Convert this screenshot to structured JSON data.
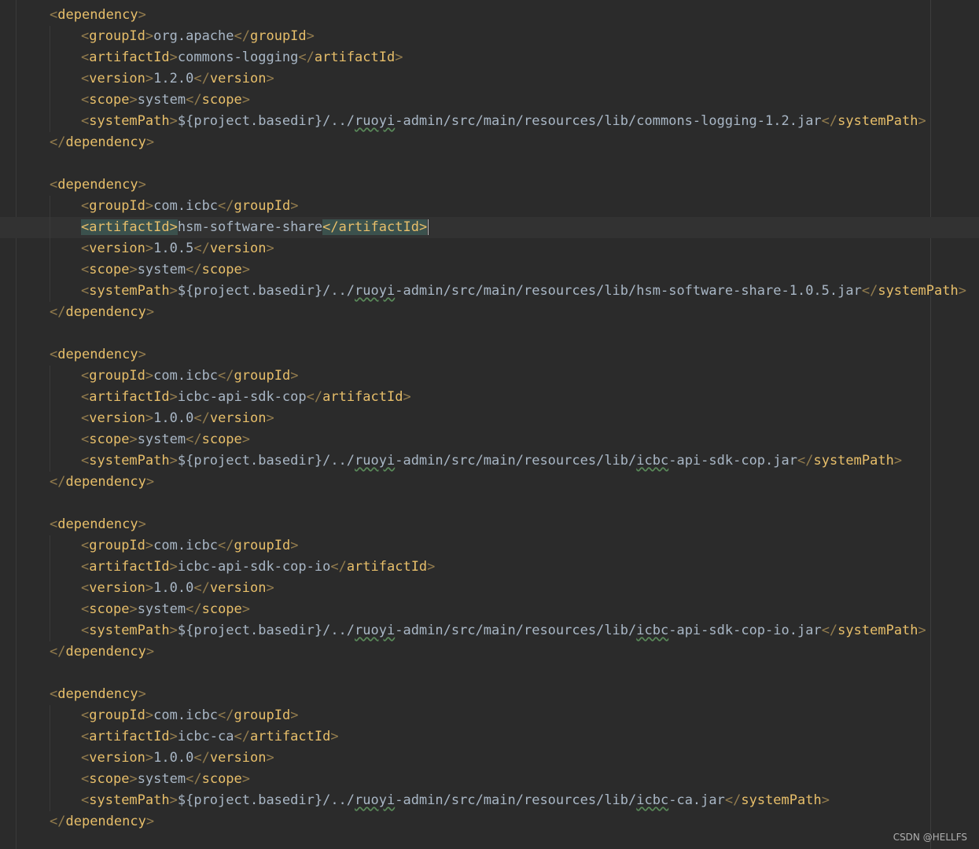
{
  "watermark": "CSDN @HELLFS",
  "current_line": 10,
  "caret_line": 10,
  "lines": [
    {
      "indent": 0,
      "parts": [
        [
          "br",
          "<"
        ],
        [
          "tag",
          "dependency"
        ],
        [
          "br",
          ">"
        ]
      ]
    },
    {
      "indent": 1,
      "parts": [
        [
          "br",
          "<"
        ],
        [
          "tag",
          "groupId"
        ],
        [
          "br",
          ">"
        ],
        [
          "txt",
          "org.apache"
        ],
        [
          "br",
          "</"
        ],
        [
          "tag",
          "groupId"
        ],
        [
          "br",
          ">"
        ]
      ]
    },
    {
      "indent": 1,
      "parts": [
        [
          "br",
          "<"
        ],
        [
          "tag",
          "artifactId"
        ],
        [
          "br",
          ">"
        ],
        [
          "txt",
          "commons-logging"
        ],
        [
          "br",
          "</"
        ],
        [
          "tag",
          "artifactId"
        ],
        [
          "br",
          ">"
        ]
      ]
    },
    {
      "indent": 1,
      "parts": [
        [
          "br",
          "<"
        ],
        [
          "tag",
          "version"
        ],
        [
          "br",
          ">"
        ],
        [
          "txt",
          "1.2.0"
        ],
        [
          "br",
          "</"
        ],
        [
          "tag",
          "version"
        ],
        [
          "br",
          ">"
        ]
      ]
    },
    {
      "indent": 1,
      "parts": [
        [
          "br",
          "<"
        ],
        [
          "tag",
          "scope"
        ],
        [
          "br",
          ">"
        ],
        [
          "txt",
          "system"
        ],
        [
          "br",
          "</"
        ],
        [
          "tag",
          "scope"
        ],
        [
          "br",
          ">"
        ]
      ]
    },
    {
      "indent": 1,
      "parts": [
        [
          "br",
          "<"
        ],
        [
          "tag",
          "systemPath"
        ],
        [
          "br",
          ">"
        ],
        [
          "txt",
          "${project.basedir}/../"
        ],
        [
          "sq",
          "ruoyi"
        ],
        [
          "txt",
          "-admin/src/main/resources/lib/commons-logging-1.2.jar"
        ],
        [
          "br",
          "</"
        ],
        [
          "tag",
          "systemPath"
        ],
        [
          "br",
          ">"
        ]
      ]
    },
    {
      "indent": 0,
      "parts": [
        [
          "br",
          "</"
        ],
        [
          "tag",
          "dependency"
        ],
        [
          "br",
          ">"
        ]
      ]
    },
    {
      "indent": -1,
      "parts": []
    },
    {
      "indent": 0,
      "parts": [
        [
          "br",
          "<"
        ],
        [
          "tag",
          "dependency"
        ],
        [
          "br",
          ">"
        ]
      ]
    },
    {
      "indent": 1,
      "parts": [
        [
          "br",
          "<"
        ],
        [
          "tag",
          "groupId"
        ],
        [
          "br",
          ">"
        ],
        [
          "txt",
          "com.icbc"
        ],
        [
          "br",
          "</"
        ],
        [
          "tag",
          "groupId"
        ],
        [
          "br",
          ">"
        ]
      ]
    },
    {
      "indent": 1,
      "parts": [
        [
          "br hl",
          "<"
        ],
        [
          "tag hl",
          "artifactId"
        ],
        [
          "br hl",
          ">"
        ],
        [
          "txt",
          "hsm-software-share"
        ],
        [
          "br hl",
          "</"
        ],
        [
          "tag hl",
          "artifactId"
        ],
        [
          "br hl",
          ">"
        ]
      ]
    },
    {
      "indent": 1,
      "parts": [
        [
          "br",
          "<"
        ],
        [
          "tag",
          "version"
        ],
        [
          "br",
          ">"
        ],
        [
          "txt",
          "1.0.5"
        ],
        [
          "br",
          "</"
        ],
        [
          "tag",
          "version"
        ],
        [
          "br",
          ">"
        ]
      ]
    },
    {
      "indent": 1,
      "parts": [
        [
          "br",
          "<"
        ],
        [
          "tag",
          "scope"
        ],
        [
          "br",
          ">"
        ],
        [
          "txt",
          "system"
        ],
        [
          "br",
          "</"
        ],
        [
          "tag",
          "scope"
        ],
        [
          "br",
          ">"
        ]
      ]
    },
    {
      "indent": 1,
      "parts": [
        [
          "br",
          "<"
        ],
        [
          "tag",
          "systemPath"
        ],
        [
          "br",
          ">"
        ],
        [
          "txt",
          "${project.basedir}/../"
        ],
        [
          "sq",
          "ruoyi"
        ],
        [
          "txt",
          "-admin/src/main/resources/lib/hsm-software-share-1.0.5.jar"
        ],
        [
          "br",
          "</"
        ],
        [
          "tag",
          "systemPath"
        ],
        [
          "br",
          ">"
        ]
      ]
    },
    {
      "indent": 0,
      "parts": [
        [
          "br",
          "</"
        ],
        [
          "tag",
          "dependency"
        ],
        [
          "br",
          ">"
        ]
      ]
    },
    {
      "indent": -1,
      "parts": []
    },
    {
      "indent": 0,
      "parts": [
        [
          "br",
          "<"
        ],
        [
          "tag",
          "dependency"
        ],
        [
          "br",
          ">"
        ]
      ]
    },
    {
      "indent": 1,
      "parts": [
        [
          "br",
          "<"
        ],
        [
          "tag",
          "groupId"
        ],
        [
          "br",
          ">"
        ],
        [
          "txt",
          "com.icbc"
        ],
        [
          "br",
          "</"
        ],
        [
          "tag",
          "groupId"
        ],
        [
          "br",
          ">"
        ]
      ]
    },
    {
      "indent": 1,
      "parts": [
        [
          "br",
          "<"
        ],
        [
          "tag",
          "artifactId"
        ],
        [
          "br",
          ">"
        ],
        [
          "txt",
          "icbc-api-sdk-cop"
        ],
        [
          "br",
          "</"
        ],
        [
          "tag",
          "artifactId"
        ],
        [
          "br",
          ">"
        ]
      ]
    },
    {
      "indent": 1,
      "parts": [
        [
          "br",
          "<"
        ],
        [
          "tag",
          "version"
        ],
        [
          "br",
          ">"
        ],
        [
          "txt",
          "1.0.0"
        ],
        [
          "br",
          "</"
        ],
        [
          "tag",
          "version"
        ],
        [
          "br",
          ">"
        ]
      ]
    },
    {
      "indent": 1,
      "parts": [
        [
          "br",
          "<"
        ],
        [
          "tag",
          "scope"
        ],
        [
          "br",
          ">"
        ],
        [
          "txt",
          "system"
        ],
        [
          "br",
          "</"
        ],
        [
          "tag",
          "scope"
        ],
        [
          "br",
          ">"
        ]
      ]
    },
    {
      "indent": 1,
      "parts": [
        [
          "br",
          "<"
        ],
        [
          "tag",
          "systemPath"
        ],
        [
          "br",
          ">"
        ],
        [
          "txt",
          "${project.basedir}/../"
        ],
        [
          "sq",
          "ruoyi"
        ],
        [
          "txt",
          "-admin/src/main/resources/lib/"
        ],
        [
          "sq",
          "icbc"
        ],
        [
          "txt",
          "-api-sdk-cop.jar"
        ],
        [
          "br",
          "</"
        ],
        [
          "tag",
          "systemPath"
        ],
        [
          "br",
          ">"
        ]
      ]
    },
    {
      "indent": 0,
      "parts": [
        [
          "br",
          "</"
        ],
        [
          "tag",
          "dependency"
        ],
        [
          "br",
          ">"
        ]
      ]
    },
    {
      "indent": -1,
      "parts": []
    },
    {
      "indent": 0,
      "parts": [
        [
          "br",
          "<"
        ],
        [
          "tag",
          "dependency"
        ],
        [
          "br",
          ">"
        ]
      ]
    },
    {
      "indent": 1,
      "parts": [
        [
          "br",
          "<"
        ],
        [
          "tag",
          "groupId"
        ],
        [
          "br",
          ">"
        ],
        [
          "txt",
          "com.icbc"
        ],
        [
          "br",
          "</"
        ],
        [
          "tag",
          "groupId"
        ],
        [
          "br",
          ">"
        ]
      ]
    },
    {
      "indent": 1,
      "parts": [
        [
          "br",
          "<"
        ],
        [
          "tag",
          "artifactId"
        ],
        [
          "br",
          ">"
        ],
        [
          "txt",
          "icbc-api-sdk-cop-io"
        ],
        [
          "br",
          "</"
        ],
        [
          "tag",
          "artifactId"
        ],
        [
          "br",
          ">"
        ]
      ]
    },
    {
      "indent": 1,
      "parts": [
        [
          "br",
          "<"
        ],
        [
          "tag",
          "version"
        ],
        [
          "br",
          ">"
        ],
        [
          "txt",
          "1.0.0"
        ],
        [
          "br",
          "</"
        ],
        [
          "tag",
          "version"
        ],
        [
          "br",
          ">"
        ]
      ]
    },
    {
      "indent": 1,
      "parts": [
        [
          "br",
          "<"
        ],
        [
          "tag",
          "scope"
        ],
        [
          "br",
          ">"
        ],
        [
          "txt",
          "system"
        ],
        [
          "br",
          "</"
        ],
        [
          "tag",
          "scope"
        ],
        [
          "br",
          ">"
        ]
      ]
    },
    {
      "indent": 1,
      "parts": [
        [
          "br",
          "<"
        ],
        [
          "tag",
          "systemPath"
        ],
        [
          "br",
          ">"
        ],
        [
          "txt",
          "${project.basedir}/../"
        ],
        [
          "sq",
          "ruoyi"
        ],
        [
          "txt",
          "-admin/src/main/resources/lib/"
        ],
        [
          "sq",
          "icbc"
        ],
        [
          "txt",
          "-api-sdk-cop-io.jar"
        ],
        [
          "br",
          "</"
        ],
        [
          "tag",
          "systemPath"
        ],
        [
          "br",
          ">"
        ]
      ]
    },
    {
      "indent": 0,
      "parts": [
        [
          "br",
          "</"
        ],
        [
          "tag",
          "dependency"
        ],
        [
          "br",
          ">"
        ]
      ]
    },
    {
      "indent": -1,
      "parts": []
    },
    {
      "indent": 0,
      "parts": [
        [
          "br",
          "<"
        ],
        [
          "tag",
          "dependency"
        ],
        [
          "br",
          ">"
        ]
      ]
    },
    {
      "indent": 1,
      "parts": [
        [
          "br",
          "<"
        ],
        [
          "tag",
          "groupId"
        ],
        [
          "br",
          ">"
        ],
        [
          "txt",
          "com.icbc"
        ],
        [
          "br",
          "</"
        ],
        [
          "tag",
          "groupId"
        ],
        [
          "br",
          ">"
        ]
      ]
    },
    {
      "indent": 1,
      "parts": [
        [
          "br",
          "<"
        ],
        [
          "tag",
          "artifactId"
        ],
        [
          "br",
          ">"
        ],
        [
          "txt",
          "icbc-ca"
        ],
        [
          "br",
          "</"
        ],
        [
          "tag",
          "artifactId"
        ],
        [
          "br",
          ">"
        ]
      ]
    },
    {
      "indent": 1,
      "parts": [
        [
          "br",
          "<"
        ],
        [
          "tag",
          "version"
        ],
        [
          "br",
          ">"
        ],
        [
          "txt",
          "1.0.0"
        ],
        [
          "br",
          "</"
        ],
        [
          "tag",
          "version"
        ],
        [
          "br",
          ">"
        ]
      ]
    },
    {
      "indent": 1,
      "parts": [
        [
          "br",
          "<"
        ],
        [
          "tag",
          "scope"
        ],
        [
          "br",
          ">"
        ],
        [
          "txt",
          "system"
        ],
        [
          "br",
          "</"
        ],
        [
          "tag",
          "scope"
        ],
        [
          "br",
          ">"
        ]
      ]
    },
    {
      "indent": 1,
      "parts": [
        [
          "br",
          "<"
        ],
        [
          "tag",
          "systemPath"
        ],
        [
          "br",
          ">"
        ],
        [
          "txt",
          "${project.basedir}/../"
        ],
        [
          "sq",
          "ruoyi"
        ],
        [
          "txt",
          "-admin/src/main/resources/lib/"
        ],
        [
          "sq",
          "icbc"
        ],
        [
          "txt",
          "-ca.jar"
        ],
        [
          "br",
          "</"
        ],
        [
          "tag",
          "systemPath"
        ],
        [
          "br",
          ">"
        ]
      ]
    },
    {
      "indent": 0,
      "parts": [
        [
          "br",
          "</"
        ],
        [
          "tag",
          "dependency"
        ],
        [
          "br",
          ">"
        ]
      ]
    }
  ]
}
